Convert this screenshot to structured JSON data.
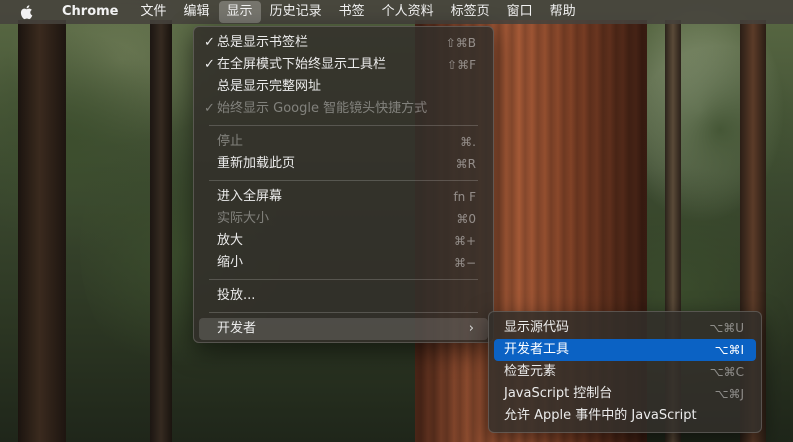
{
  "menubar": {
    "apple_icon": "apple-logo-icon",
    "app_name": "Chrome",
    "items": [
      "文件",
      "编辑",
      "显示",
      "历史记录",
      "书签",
      "个人资料",
      "标签页",
      "窗口",
      "帮助"
    ],
    "active_item": "显示"
  },
  "view_menu": {
    "items": [
      {
        "label": "总是显示书签栏",
        "shortcut": "⇧⌘B",
        "checked": "✓"
      },
      {
        "label": "在全屏模式下始终显示工具栏",
        "shortcut": "⇧⌘F",
        "checked": "✓"
      },
      {
        "label": "总是显示完整网址"
      },
      {
        "label": "始终显示 Google 智能镜头快捷方式",
        "checked": "✓",
        "disabled": true
      },
      {
        "label": "停止",
        "shortcut": "⌘.",
        "disabled": true
      },
      {
        "label": "重新加载此页",
        "shortcut": "⌘R"
      },
      {
        "label": "进入全屏幕",
        "shortcut": "fn F"
      },
      {
        "label": "实际大小",
        "shortcut": "⌘0",
        "disabled": true
      },
      {
        "label": "放大",
        "shortcut": "⌘+"
      },
      {
        "label": "缩小",
        "shortcut": "⌘−"
      },
      {
        "label": "投放..."
      },
      {
        "label": "开发者",
        "submenu_arrow": "›"
      }
    ]
  },
  "developer_menu": {
    "items": [
      {
        "label": "显示源代码",
        "shortcut": "⌥⌘U"
      },
      {
        "label": "开发者工具",
        "shortcut": "⌥⌘I",
        "highlighted": true
      },
      {
        "label": "检查元素",
        "shortcut": "⌥⌘C"
      },
      {
        "label": "JavaScript 控制台",
        "shortcut": "⌥⌘J"
      },
      {
        "label": "允许 Apple 事件中的 JavaScript"
      }
    ]
  },
  "colors": {
    "highlight": "#0b62c4",
    "menubar_bg": "#46423c",
    "menu_bg": "#322e2a"
  }
}
